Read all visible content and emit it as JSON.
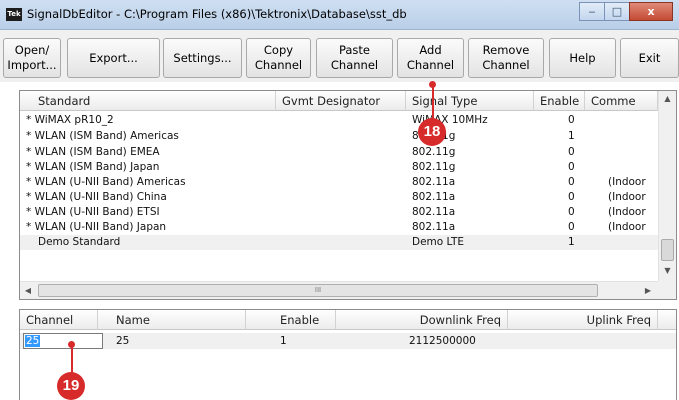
{
  "window": {
    "title": "SignalDbEditor - C:\\Program Files (x86)\\Tektronix\\Database\\sst_db",
    "icon_text": "Tek",
    "minimize_glyph": "‒",
    "maximize_glyph": "□",
    "close_glyph": "x"
  },
  "toolbar": {
    "open_import": "Open/\nImport...",
    "export": "Export...",
    "settings": "Settings...",
    "copy_channel": "Copy\nChannel",
    "paste_channel": "Paste\nChannel",
    "add_channel": "Add\nChannel",
    "remove_channel": "Remove\nChannel",
    "help": "Help",
    "exit": "Exit"
  },
  "standards_table": {
    "columns": [
      "Standard",
      "Gvmt Designator",
      "Signal Type",
      "Enable",
      "Comme"
    ],
    "rows": [
      {
        "standard": "* WiMAX pR10_2",
        "gvmt": "",
        "signal_type": "WiMAX 10MHz",
        "enable": "0",
        "comment": ""
      },
      {
        "standard": "* WLAN (ISM Band) Americas",
        "gvmt": "",
        "signal_type": "802.11g",
        "enable": "1",
        "comment": ""
      },
      {
        "standard": "* WLAN (ISM Band) EMEA",
        "gvmt": "",
        "signal_type": "802.11g",
        "enable": "0",
        "comment": ""
      },
      {
        "standard": "* WLAN (ISM Band) Japan",
        "gvmt": "",
        "signal_type": "802.11g",
        "enable": "0",
        "comment": ""
      },
      {
        "standard": "* WLAN (U-NII Band) Americas",
        "gvmt": "",
        "signal_type": "802.11a",
        "enable": "0",
        "comment": "(Indoor"
      },
      {
        "standard": "* WLAN (U-NII Band) China",
        "gvmt": "",
        "signal_type": "802.11a",
        "enable": "0",
        "comment": "(Indoor"
      },
      {
        "standard": "* WLAN (U-NII Band) ETSI",
        "gvmt": "",
        "signal_type": "802.11a",
        "enable": "0",
        "comment": "(Indoor"
      },
      {
        "standard": "* WLAN (U-NII Band) Japan",
        "gvmt": "",
        "signal_type": "802.11a",
        "enable": "0",
        "comment": "(Indoor"
      },
      {
        "standard": "Demo Standard",
        "gvmt": "",
        "signal_type": "Demo LTE",
        "enable": "1",
        "comment": ""
      }
    ],
    "selected_row": 8,
    "scroll_up_glyph": "▲",
    "scroll_down_glyph": "▼",
    "scroll_left_glyph": "◀",
    "scroll_right_glyph": "▶",
    "hthumb_grip": "III"
  },
  "channel_table": {
    "columns": [
      "Channel",
      "Name",
      "Enable",
      "Downlink Freq",
      "Uplink Freq"
    ],
    "rows": [
      {
        "channel": "25",
        "name": "25",
        "enable": "1",
        "downlink": "2112500000",
        "uplink": ""
      }
    ],
    "editing_value": "25"
  },
  "callouts": {
    "c18": "18",
    "c19": "19"
  },
  "colors": {
    "callout": "#d72a2a",
    "selection": "#3399ff"
  }
}
